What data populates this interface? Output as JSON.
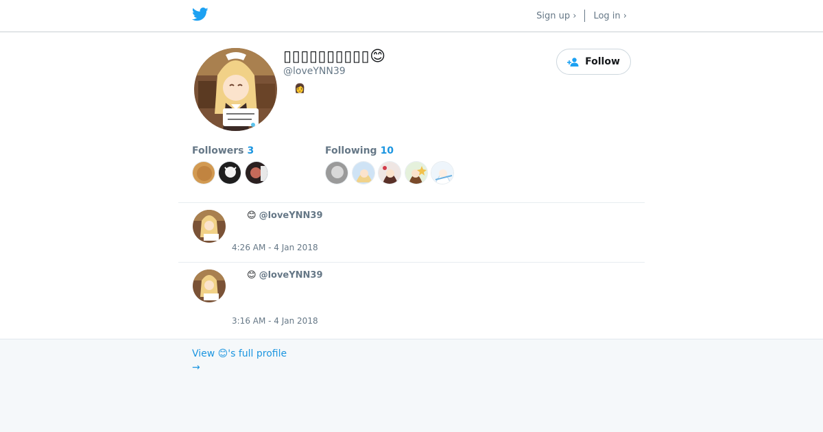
{
  "header": {
    "logo_icon": "twitter-bird-icon",
    "signup_label": "Sign up ›",
    "login_label": "Log in ›",
    "accent": "#1da1f2"
  },
  "profile": {
    "display_name": "▯▯▯▯▯▯▯▯▯▯😊",
    "handle": "@loveYNN39",
    "bio_emoji": "👩",
    "follow_label": "Follow",
    "followers_label": "Followers",
    "followers_count": "3",
    "following_label": "Following",
    "following_count": "10"
  },
  "tweets": [
    {
      "author_emoji": "😊",
      "author_handle": "@loveYNN39",
      "time": "4:26 AM - 4 Jan 2018"
    },
    {
      "author_emoji": "😊",
      "author_handle": "@loveYNN39",
      "time": "3:16 AM - 4 Jan 2018"
    }
  ],
  "footer": {
    "full_profile_label": "View 😊's full profile",
    "arrow": "→"
  }
}
